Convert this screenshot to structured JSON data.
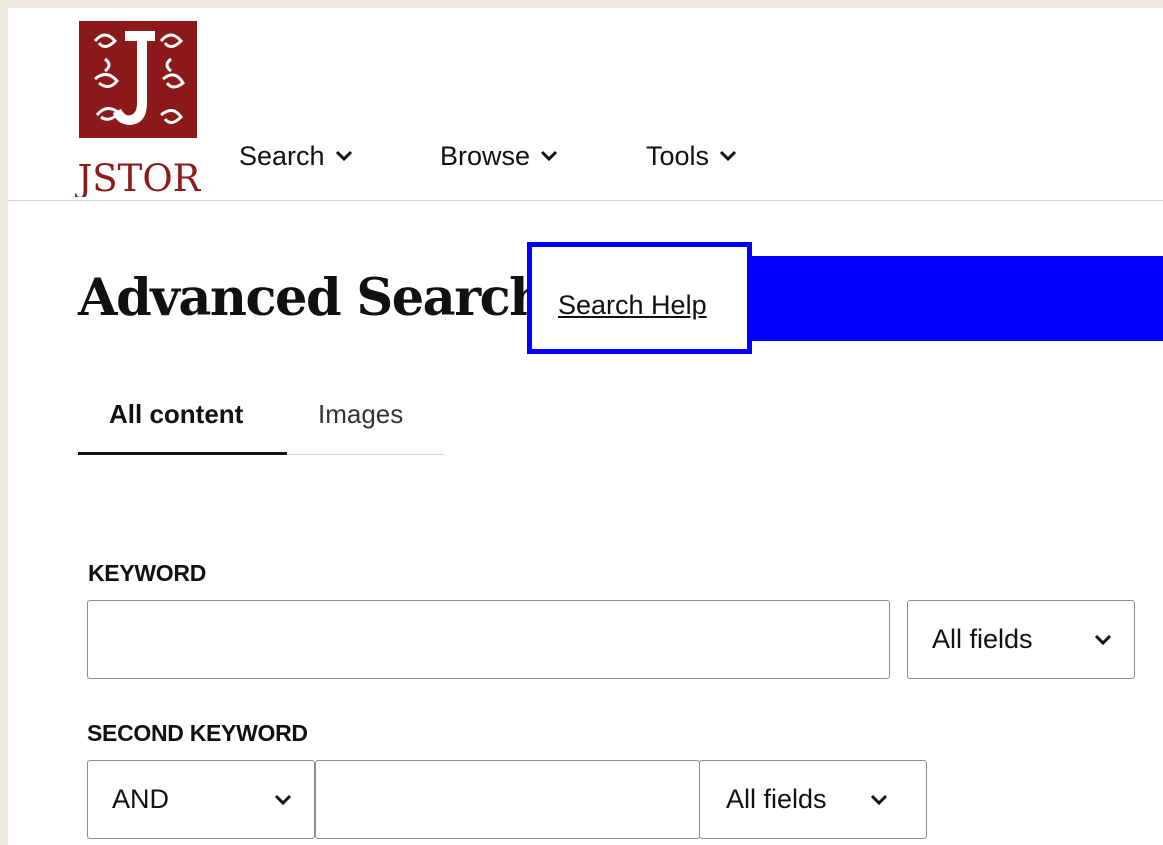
{
  "header": {
    "logo_text": "JSTOR",
    "nav": [
      {
        "label": "Search",
        "icon": "chevron-down-icon"
      },
      {
        "label": "Browse",
        "icon": "chevron-down-icon"
      },
      {
        "label": "Tools",
        "icon": "chevron-down-icon"
      }
    ]
  },
  "page": {
    "title": "Advanced Search",
    "help_link": "Search Help",
    "highlight_color": "#0000ff"
  },
  "tabs": [
    {
      "label": "All content",
      "active": true
    },
    {
      "label": "Images",
      "active": false
    }
  ],
  "form": {
    "keyword": {
      "label": "KEYWORD",
      "value": "",
      "field_select": "All fields"
    },
    "second_keyword": {
      "label": "SECOND KEYWORD",
      "operator": "AND",
      "value": "",
      "field_select": "All fields"
    }
  },
  "colors": {
    "logo_red": "#8c1a1a",
    "text": "#111111",
    "border": "#8c8c8c"
  }
}
